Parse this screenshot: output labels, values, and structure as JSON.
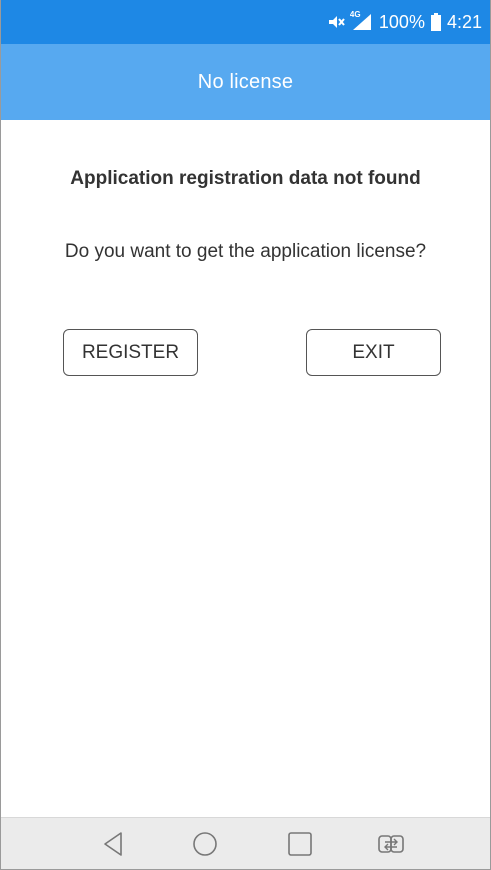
{
  "status_bar": {
    "network": "4G",
    "battery": "100%",
    "time": "4:21",
    "icons": [
      "mute-icon",
      "signal-icon",
      "battery-icon"
    ]
  },
  "app_bar": {
    "title": "No license"
  },
  "dialog": {
    "heading": "Application registration data not found",
    "question": "Do you want to get the application license?",
    "register_label": "REGISTER",
    "exit_label": "EXIT"
  },
  "nav_bar": {
    "icons": [
      "back-icon",
      "home-icon",
      "recents-icon",
      "dual-window-icon"
    ]
  },
  "colors": {
    "status_bar": "#1e88e5",
    "app_bar": "#57a9f0",
    "nav_bar": "#ebebeb",
    "text": "#333333"
  }
}
